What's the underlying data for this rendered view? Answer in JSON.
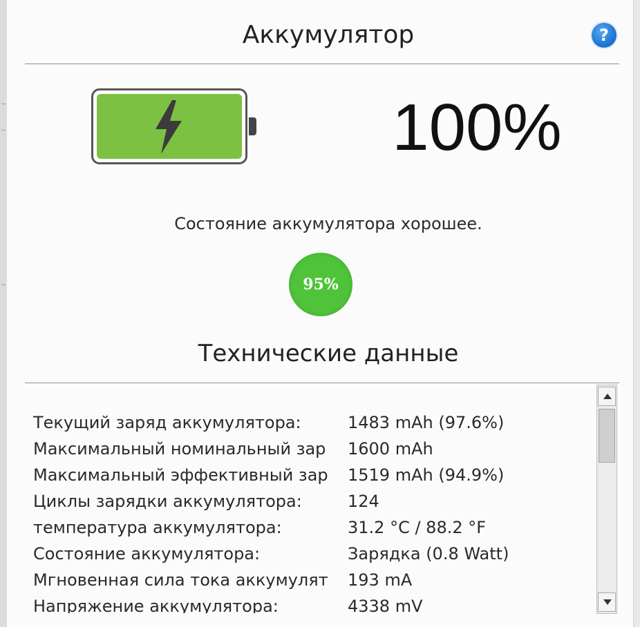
{
  "header": {
    "title": "Аккумулятор",
    "help_symbol": "?"
  },
  "battery": {
    "level_text": "100%",
    "level": 1.0,
    "fill_color": "#7cc142",
    "icon": "battery-charging-icon"
  },
  "health": {
    "status_text": "Состояние аккумулятора хорошее.",
    "badge": "95%",
    "badge_color": "#4fc43a"
  },
  "tech": {
    "title": "Технические данные",
    "rows": [
      {
        "label": "Текущий заряд аккумулятора:",
        "value": "1483 mAh (97.6%)"
      },
      {
        "label": "Максимальный номинальный зар",
        "value": "1600 mAh"
      },
      {
        "label": "Максимальный эффективный зар",
        "value": "1519 mAh (94.9%)"
      },
      {
        "label": "Циклы зарядки аккумулятора:",
        "value": "124"
      },
      {
        "label": "температура аккумулятора:",
        "value": "31.2 °C / 88.2 °F"
      },
      {
        "label": "Состояние аккумулятора:",
        "value": "Зарядка (0.8 Watt)"
      },
      {
        "label": "Мгновенная сила тока аккумулят",
        "value": "193 mA"
      },
      {
        "label": "Напряжение аккумулятора:",
        "value": "4338 mV"
      }
    ]
  }
}
